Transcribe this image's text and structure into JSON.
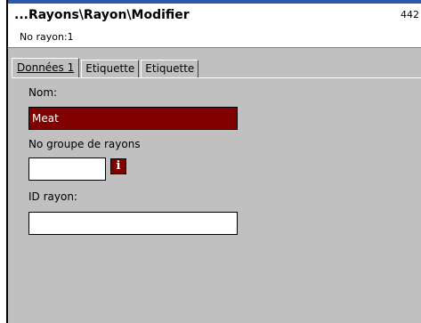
{
  "window": {
    "title": "...Rayons\\Rayon\\Modifier",
    "title_right": "442",
    "subtitle": "No rayon:1"
  },
  "tabs": [
    {
      "label": "Données 1",
      "active": true
    },
    {
      "label": "Etiquette",
      "active": false
    },
    {
      "label": "Etiquette",
      "active": false
    }
  ],
  "form": {
    "nom_label": "Nom:",
    "nom_value": "Meat",
    "groupe_label": "No groupe de rayons",
    "groupe_value": "",
    "id_label": "ID rayon:",
    "id_value": ""
  },
  "icons": {
    "info": "info-icon"
  },
  "colors": {
    "selection": "#800000",
    "panel": "#c0c0c0",
    "accent_bar": "#2a5aa8"
  }
}
